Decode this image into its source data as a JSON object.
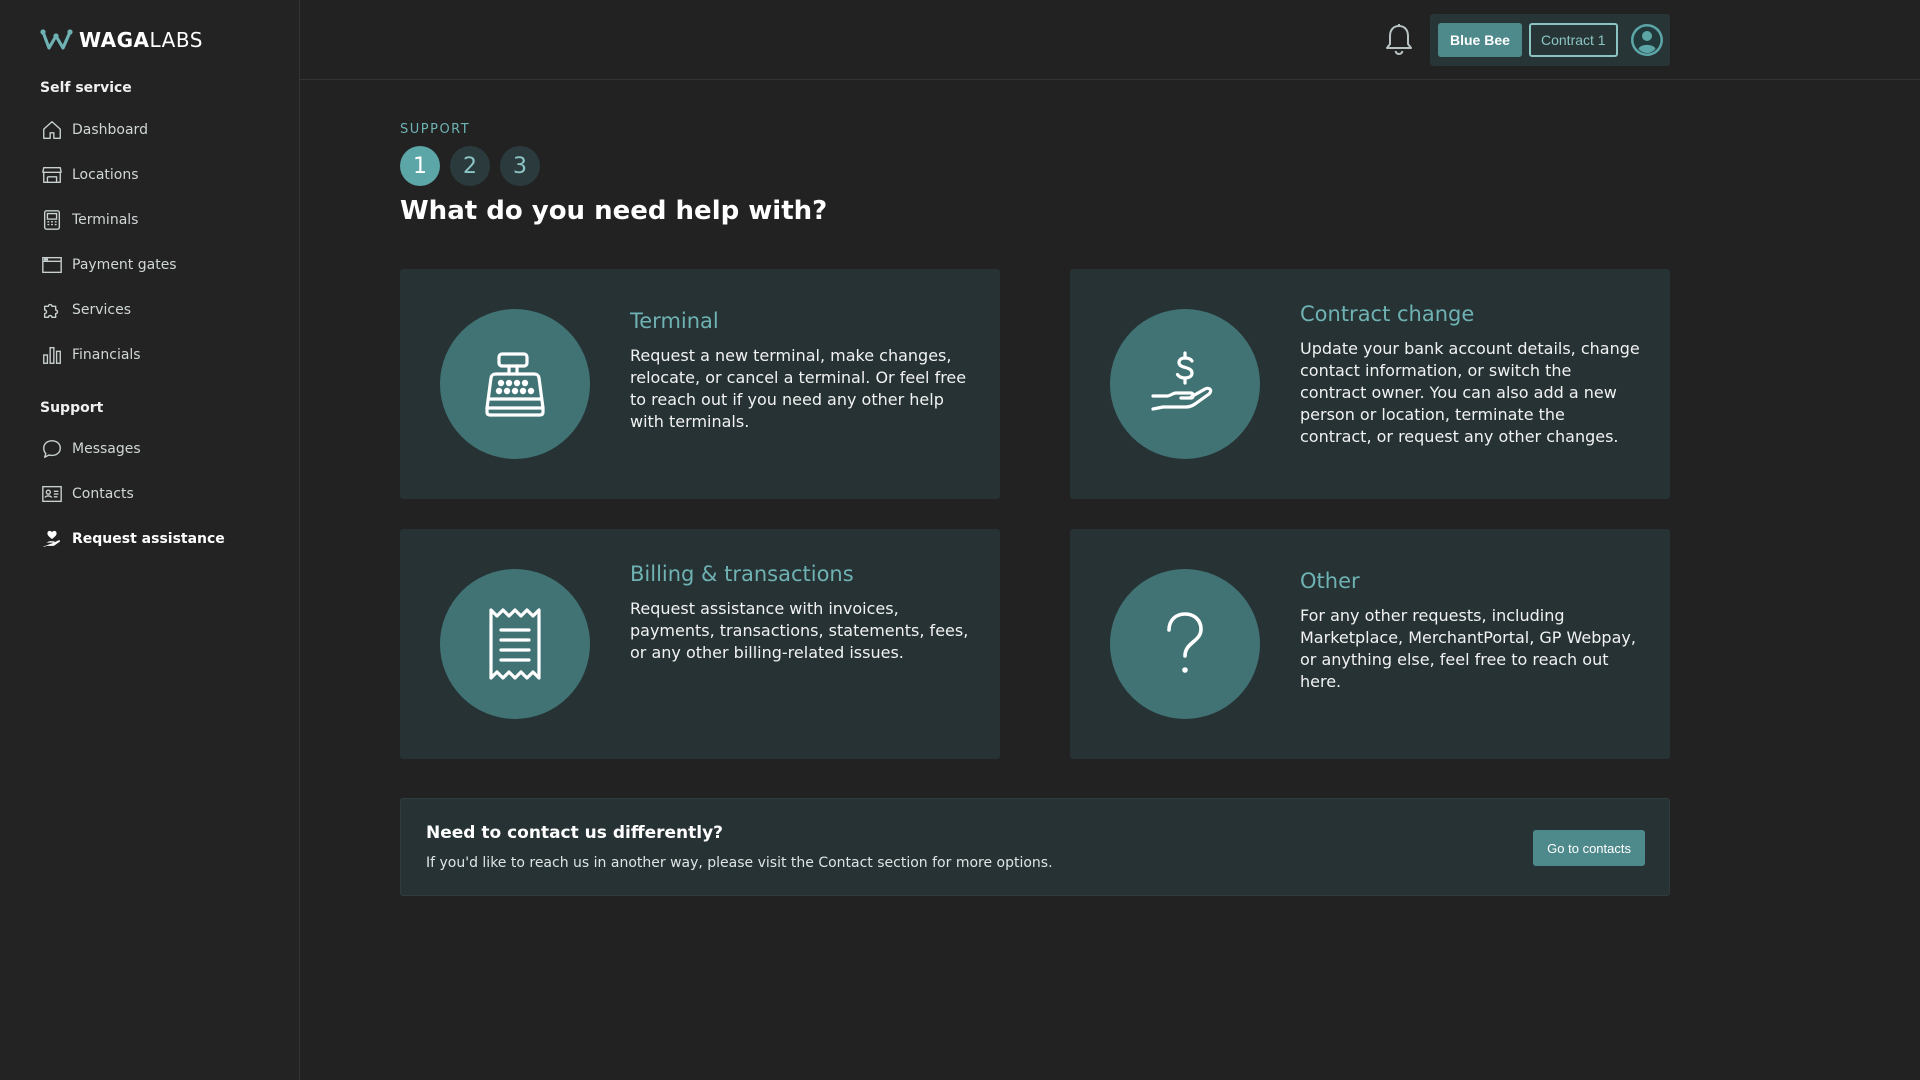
{
  "brand": {
    "name_bold": "WAGA",
    "name_light": "LABS"
  },
  "sidebar": {
    "self_service_title": "Self service",
    "self_service_items": [
      {
        "label": "Dashboard",
        "icon": "home-icon"
      },
      {
        "label": "Locations",
        "icon": "store-icon"
      },
      {
        "label": "Terminals",
        "icon": "terminal-icon"
      },
      {
        "label": "Payment gates",
        "icon": "window-icon"
      },
      {
        "label": "Services",
        "icon": "puzzle-icon"
      },
      {
        "label": "Financials",
        "icon": "bar-chart-icon"
      }
    ],
    "support_title": "Support",
    "support_items": [
      {
        "label": "Messages",
        "icon": "chat-bubble-icon"
      },
      {
        "label": "Contacts",
        "icon": "contact-card-icon"
      },
      {
        "label": "Request assistance",
        "icon": "hand-heart-icon",
        "active": true
      }
    ]
  },
  "header": {
    "account_label": "Blue Bee",
    "contract_label": "Contract 1",
    "notification_icon": "bell-icon",
    "avatar_icon": "user-avatar-icon"
  },
  "main": {
    "section_label": "SUPPORT",
    "steps": [
      "1",
      "2",
      "3"
    ],
    "active_step": 1,
    "title": "What do you need help with?",
    "cards": [
      {
        "title": "Terminal",
        "description": "Request a new terminal, make changes, relocate, or cancel a terminal. Or feel free to reach out if you need any other help with terminals.",
        "icon": "cash-register-icon"
      },
      {
        "title": "Contract change",
        "description": "Update your bank account details, change contact information, or switch the contract owner. You can also add a new person or location, terminate the contract, or request any other changes.",
        "icon": "dollar-hand-icon"
      },
      {
        "title": "Billing & transactions",
        "description": "Request assistance with invoices, payments, transactions, statements, fees, or any other billing-related issues.",
        "icon": "receipt-icon"
      },
      {
        "title": "Other",
        "description": "For any other requests, including Marketplace, MerchantPortal, GP Webpay, or anything else, feel free to reach out here.",
        "icon": "question-mark-icon"
      }
    ],
    "contact_banner": {
      "title": "Need to contact us differently?",
      "description": "If you'd like to reach us in another way, please visit the Contact section for more options.",
      "button_label": "Go to contacts"
    }
  },
  "colors": {
    "background": "#222222",
    "card_bg": "#263234",
    "accent": "#6fb2b3",
    "button_bg": "#4e8a8c",
    "icon_circle": "#417375"
  }
}
